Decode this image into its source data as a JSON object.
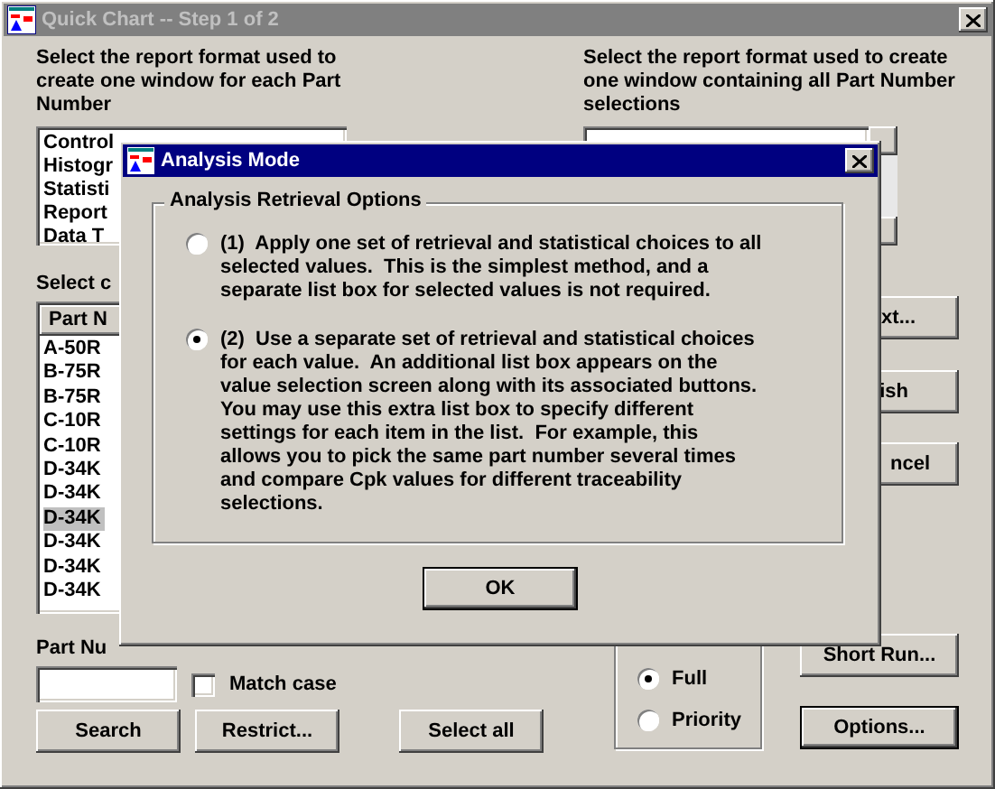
{
  "main_window": {
    "title": "Quick Chart -- Step 1 of 2",
    "left_prompt": "Select the report format used to create one window for each Part Number",
    "left_formats": [
      "Control",
      "Histogr",
      "Statisti",
      "Report",
      "Data T"
    ],
    "select_label": "Select c",
    "part_list": {
      "header": "Part N",
      "rows": [
        {
          "text": "A-50R",
          "selected": false
        },
        {
          "text": "B-75R",
          "selected": false
        },
        {
          "text": "B-75R",
          "selected": false
        },
        {
          "text": "C-10R",
          "selected": false
        },
        {
          "text": "C-10R",
          "selected": false
        },
        {
          "text": "D-34K",
          "selected": false
        },
        {
          "text": "D-34K",
          "selected": false
        },
        {
          "text": "D-34K",
          "selected": true
        },
        {
          "text": "D-34K",
          "selected": false
        },
        {
          "text": "D-34K",
          "selected": false
        },
        {
          "text": "D-34K",
          "selected": false
        }
      ]
    },
    "search_label": "Part Nu",
    "match_case": {
      "label": "Match case",
      "checked": false
    },
    "buttons": [
      "Search",
      "Restrict...",
      "Select all"
    ],
    "right_prompt": "Select the report format used to create one window containing all Part Number selections",
    "side_buttons": [
      {
        "label": "xt...",
        "default": false
      },
      {
        "label": "ish",
        "default": false
      },
      {
        "label": "ncel",
        "default": false
      },
      {
        "label": "Short Run...",
        "default": false
      },
      {
        "label": "Options...",
        "default": true
      }
    ],
    "list_mode": [
      {
        "label": "Full",
        "selected": true
      },
      {
        "label": "Priority",
        "selected": false
      }
    ]
  },
  "dialog": {
    "title": "Analysis Mode",
    "group": "Analysis Retrieval Options",
    "options": [
      {
        "text": "(1)  Apply one set of retrieval and statistical choices to all selected values.  This is the simplest method, and a separate list box for selected values is not required.",
        "selected": false
      },
      {
        "text": "(2)  Use a separate set of retrieval and statistical choices for each value.  An additional list box appears on the value selection screen along with its associated buttons.  You may use this extra list box to specify different settings for each item in the list.  For example, this allows you to pick the same part number several times and compare Cpk values for different traceability selections.",
        "selected": true
      }
    ],
    "ok": "OK"
  }
}
